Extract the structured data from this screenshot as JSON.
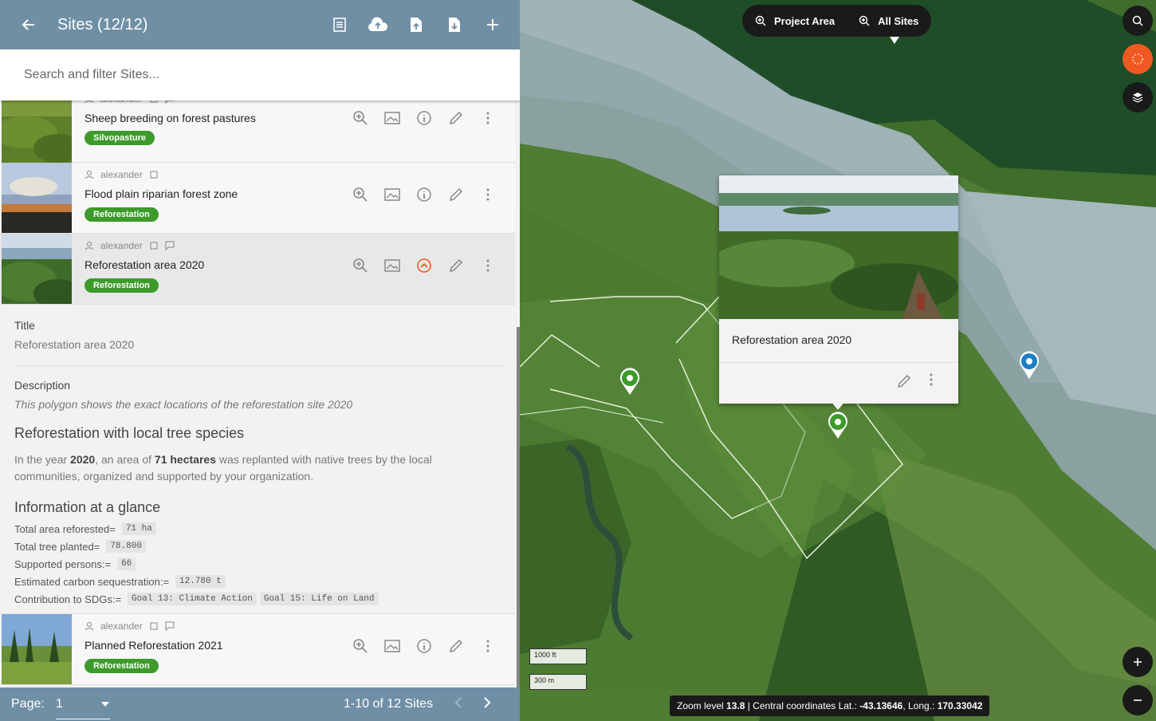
{
  "header": {
    "title": "Sites (12/12)"
  },
  "search": {
    "placeholder": "Search and filter Sites..."
  },
  "items": [
    {
      "author": "alexander",
      "name": "Sheep breeding on forest pastures",
      "tag": "Silvopasture"
    },
    {
      "author": "alexander",
      "name": "Flood plain riparian forest zone",
      "tag": "Reforestation"
    },
    {
      "author": "alexander",
      "name": "Reforestation area 2020",
      "tag": "Reforestation"
    },
    {
      "author": "alexander",
      "name": "Planned Reforestation 2021",
      "tag": "Reforestation"
    }
  ],
  "detail": {
    "title_label": "Title",
    "title_value": "Reforestation area 2020",
    "desc_label": "Description",
    "desc_value": "This polygon shows the exact locations of the reforestation site 2020",
    "heading1": "Reforestation with local tree species",
    "para_pre": "In the year ",
    "para_year": "2020",
    "para_mid": ", an area of ",
    "para_area": "71 hectares",
    "para_post": " was replanted with native trees by the local communities, organized and supported by your organization.",
    "heading2": "Information at a glance",
    "facts": [
      {
        "label": "Total area reforested",
        "eq": " =",
        "values": [
          "71 ha"
        ]
      },
      {
        "label": "Total tree planted",
        "eq": " =",
        "values": [
          "78.800"
        ]
      },
      {
        "label": "Supported persons:",
        "eq": " =",
        "values": [
          "66"
        ]
      },
      {
        "label": "Estimated carbon sequestration:",
        "eq": " =",
        "values": [
          "12.780 t"
        ]
      },
      {
        "label": "Contribution to SDGs:",
        "eq": " =",
        "values": [
          "Goal 13: Climate Action",
          "Goal 15: Life on Land"
        ]
      }
    ]
  },
  "footer": {
    "page_label": "Page:",
    "page_value": "1",
    "range": "1-10 of 12 Sites"
  },
  "map": {
    "tab_project": "Project Area",
    "tab_all": "All Sites",
    "popup_title": "Reforestation area 2020",
    "scale_ft": "1000 ft",
    "scale_m": "300 m",
    "status_pre": "Zoom level ",
    "zoom": "13.8",
    "status_mid": " | Central coordinates Lat.: ",
    "lat": "-43.13646",
    "status_mid2": ", Long.: ",
    "lng": "170.33042"
  },
  "colors": {
    "header": "#6f8fa5",
    "tag": "#3c9b2a",
    "accent": "#f05a22"
  }
}
